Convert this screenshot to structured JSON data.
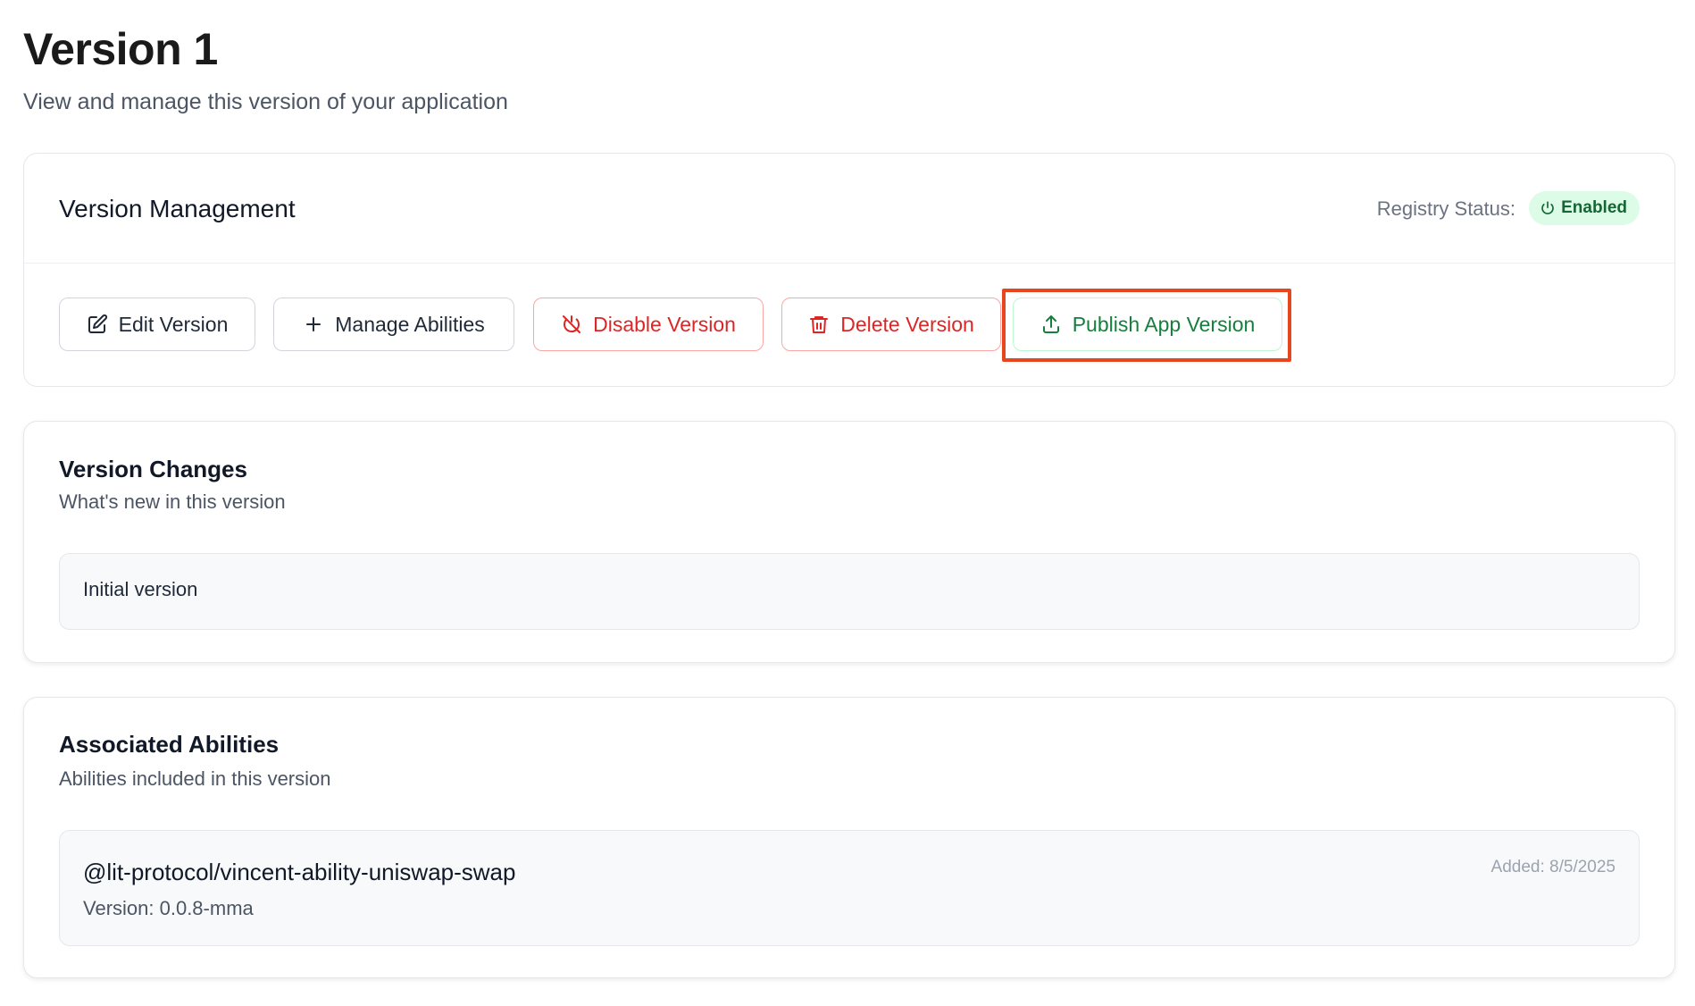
{
  "header": {
    "title": "Version 1",
    "subtitle": "View and manage this version of your application"
  },
  "version_management": {
    "title": "Version Management",
    "registry_label": "Registry Status:",
    "status": "Enabled",
    "status_icon": "power-icon",
    "actions": {
      "edit": {
        "label": "Edit Version",
        "icon": "edit-icon"
      },
      "manage": {
        "label": "Manage Abilities",
        "icon": "plus-icon"
      },
      "disable": {
        "label": "Disable Version",
        "icon": "power-off-icon"
      },
      "delete": {
        "label": "Delete Version",
        "icon": "trash-icon"
      },
      "publish": {
        "label": "Publish App Version",
        "icon": "upload-icon"
      }
    }
  },
  "version_changes": {
    "title": "Version Changes",
    "subtitle": "What's new in this version",
    "text": "Initial version"
  },
  "associated_abilities": {
    "title": "Associated Abilities",
    "subtitle": "Abilities included in this version",
    "items": [
      {
        "name": "@lit-protocol/vincent-ability-uniswap-swap",
        "version": "Version: 0.0.8-mma",
        "added": "Added: 8/5/2025"
      }
    ]
  },
  "colors": {
    "danger": "#dc2626",
    "success": "#15803d",
    "badge_bg": "#dcfce7",
    "highlight": "#e8461e"
  }
}
